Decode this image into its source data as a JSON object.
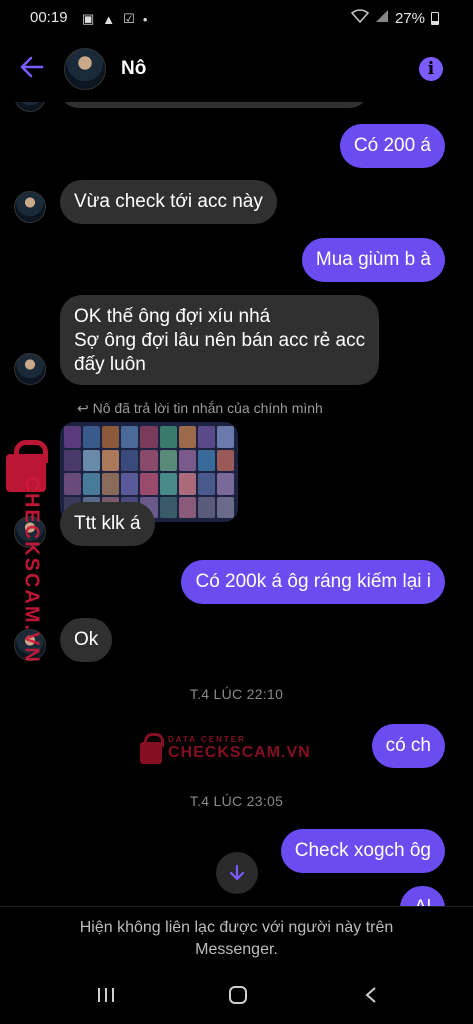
{
  "status_bar": {
    "time": "00:19",
    "battery": "27%"
  },
  "header": {
    "contact_name": "Nô"
  },
  "messages": {
    "m1": "Có 200 á",
    "m2": "Vừa check tới acc này",
    "m3": "Mua giùm b à",
    "m4_line1": "OK thế ông đợi xíu nhá",
    "m4_line2": "Sợ ông đợi lâu nên bán acc rẻ acc",
    "m4_line3": "đấy luôn",
    "reply_note": "Nô đã trả lời tin nhắn của chính mình",
    "m5": "Ttt klk á",
    "m6": "Có 200k á ôg ráng kiếm lại i",
    "m7": "Ok",
    "m8": "có ch",
    "m9": "Check xogch ôg",
    "m10": "Al"
  },
  "timestamps": {
    "t1": "T.4 LÚC 22:10",
    "t2": "T.4 LÚC 23:05"
  },
  "watermark": {
    "small": "DATA CENTER",
    "big": "CHECKSCAM.VN"
  },
  "footer": {
    "line1": "Hiện không liên lạc được với người này trên",
    "line2": "Messenger."
  },
  "colors": {
    "outgoing_bubble": "#6a4cf0",
    "incoming_bubble": "#303030",
    "accent": "#7b5cff",
    "watermark": "#d01a3a"
  }
}
